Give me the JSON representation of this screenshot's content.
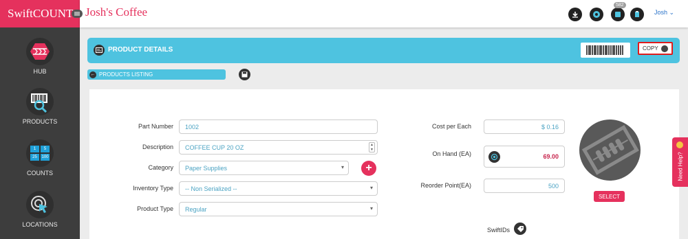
{
  "brand": {
    "name": "SwiftCOUNT"
  },
  "header": {
    "store": "Josh's Coffee",
    "notification_count": "582",
    "user": "Josh"
  },
  "sidebar": {
    "items": [
      {
        "label": "HUB",
        "icon": "hub-icon"
      },
      {
        "label": "PRODUCTS",
        "icon": "barcode-search-icon"
      },
      {
        "label": "COUNTS",
        "icon": "counts-grid-icon",
        "digits": [
          "1",
          "5",
          "25",
          "100"
        ]
      },
      {
        "label": "LOCATIONS",
        "icon": "location-target-icon"
      }
    ]
  },
  "detail": {
    "title": "PRODUCT DETAILS",
    "copy_label": "COPY",
    "listing_label": "PRODUCTS LISTING"
  },
  "form": {
    "part_number": {
      "label": "Part Number",
      "value": "1002"
    },
    "description": {
      "label": "Description",
      "value": "COFFEE CUP 20 OZ"
    },
    "category": {
      "label": "Category",
      "value": "Paper Supplies"
    },
    "inventory_type": {
      "label": "Inventory Type",
      "value": "-- Non Serialized --"
    },
    "product_type": {
      "label": "Product Type",
      "value": "Regular"
    },
    "cost": {
      "label": "Cost per Each",
      "value": "$ 0.16"
    },
    "on_hand": {
      "label": "On Hand (EA)",
      "value": "69.00"
    },
    "reorder": {
      "label": "Reorder Point(EA)",
      "value": "500"
    },
    "select_label": "SELECT",
    "swiftids_label": "SwiftIDs"
  },
  "help": {
    "label": "Need Help?"
  },
  "colors": {
    "brand": "#e5315d",
    "accent": "#4ec3e0",
    "sidebar": "#3d3d3d"
  }
}
